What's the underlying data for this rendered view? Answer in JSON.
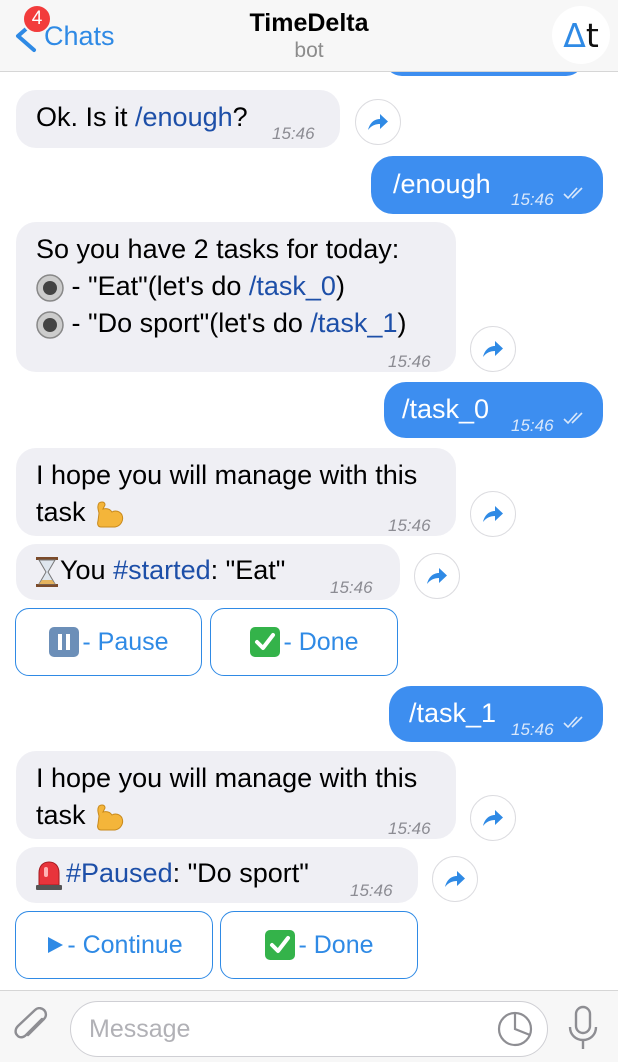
{
  "header": {
    "back_label": "Chats",
    "badge_count": "4",
    "title": "TimeDelta",
    "subtitle": "bot",
    "avatar_delta": "Δ",
    "avatar_t": "t"
  },
  "messages": {
    "m1": {
      "text_before": "Ok. Is it ",
      "link": "/enough",
      "text_after": "?",
      "time": "15:46"
    },
    "m2": {
      "text": "/enough",
      "time": "15:46"
    },
    "m3": {
      "line1": "So you have 2 tasks for today:",
      "line2_text": " - \"Eat\"(let's do ",
      "line2_link": "/task_0",
      "line2_end": ")",
      "line3_text": " - \"Do sport\"(let's do ",
      "line3_link": "/task_1",
      "line3_end": ")",
      "time": "15:46"
    },
    "m4": {
      "text": "/task_0",
      "time": "15:46"
    },
    "m5": {
      "line1": "I hope you will manage with this",
      "line2": "task",
      "time": "15:46"
    },
    "m6": {
      "text_before": "You ",
      "link": "#started",
      "text_after": ": \"Eat\"",
      "time": "15:46"
    },
    "m7": {
      "text": "/task_1",
      "time": "15:46"
    },
    "m8": {
      "line1": "I hope you will manage with this",
      "line2": "task",
      "time": "15:46"
    },
    "m9": {
      "link": "#Paused",
      "text_after": ": \"Do sport\"",
      "time": "15:46"
    }
  },
  "keyboard1": {
    "pause_label": " - Pause",
    "done_label": " - Done"
  },
  "keyboard2": {
    "continue_label": " - Continue",
    "done_label": " - Done"
  },
  "composer": {
    "placeholder": "Message"
  },
  "colors": {
    "accent": "#2f8ae5",
    "outgoing_bubble": "#3d8ef0",
    "incoming_bubble": "#efeff4",
    "link": "#1d4fa8",
    "badge": "#f23c3c"
  }
}
